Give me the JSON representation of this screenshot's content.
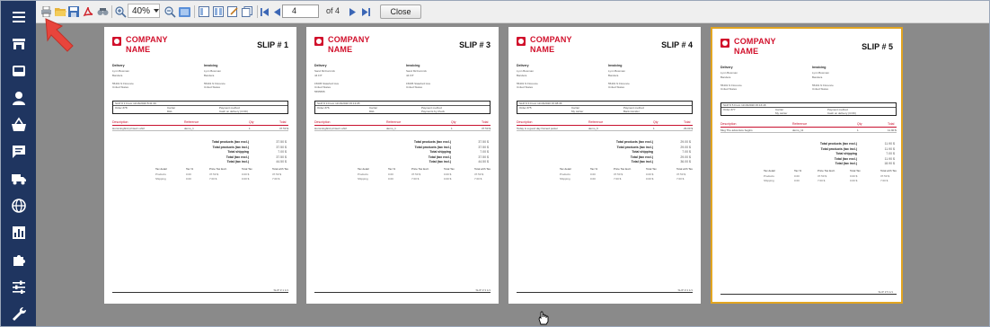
{
  "toolbar": {
    "zoom": "40%",
    "page": "4",
    "page_of": "of 4",
    "close_label": "Close"
  },
  "sidebar": {
    "items": [
      "menu-icon",
      "store-icon",
      "inbox-icon",
      "person-icon",
      "basket-icon",
      "chat-icon",
      "truck-icon",
      "globe-icon",
      "chart-icon",
      "puzzle-icon",
      "sliders-icon",
      "wrench-icon"
    ]
  },
  "colors": {
    "sidebar": "#1f3560",
    "brand_red": "#d1102b",
    "selection": "#e2a521",
    "annotation_arrow": "#e8453c"
  },
  "slips": [
    {
      "company_line1": "COMPANY",
      "company_line2": "NAME",
      "title": "SLIP # 1",
      "selected": false,
      "delivery_h": "Delivery",
      "invoicing_h": "Invoicing",
      "delivery_addr": "Lynn Bowman\nBandera\n\n55401 N Florence\nUnited States",
      "invoicing_addr": "Lynn Bowman\nBandera\n\n55401 N Florence\nUnited States",
      "info_top": "SLIP # 1 From 11/16/2020 8:31:39",
      "info_col1": "Order #78",
      "info_col2_h": "Carrier",
      "info_col2": "DHL",
      "info_col3_h": "Payment method",
      "info_col3": "Cash on delivery (COD)",
      "headers": [
        "Description",
        "Reference",
        "Qty",
        "Total"
      ],
      "product": [
        "Hummingbird printed t-shirt",
        "demo_1",
        "1",
        "37.50 $"
      ],
      "totals": [
        [
          "Total products (tax excl.)",
          "37.50 $"
        ],
        [
          "Total products (tax incl.)",
          "37.50 $"
        ],
        [
          "Total shipping",
          "7.00 $"
        ],
        [
          "Total (tax excl.)",
          "37.50 $"
        ],
        [
          "Total (tax incl.)",
          "44.50 $"
        ]
      ],
      "footer": "SLIP # 1 1/1"
    },
    {
      "company_line1": "COMPANY",
      "company_line2": "NAME",
      "title": "SLIP # 3",
      "selected": false,
      "delivery_h": "Delivery",
      "invoicing_h": "Invoicing",
      "delivery_addr": "Sand McCormick\n44 FIT\n\n15005 Stateford Ave\nUnited States\n5555555",
      "invoicing_addr": "Sand McCormick\n44 FIT\n\n15005 Stateford Ave\nUnited States",
      "info_top": "SLIP # 3 From 11/16/2020 15:13:05",
      "info_col1": "Order #76",
      "info_col2_h": "Carrier",
      "info_col2": "DHL",
      "info_col3_h": "Payment method",
      "info_col3": "Payments by check",
      "headers": [
        "Description",
        "Reference",
        "Qty",
        "Total"
      ],
      "product": [
        "Hummingbird printed t-shirt",
        "demo_1",
        "1",
        "37.50 $"
      ],
      "totals": [
        [
          "Total products (tax excl.)",
          "37.50 $"
        ],
        [
          "Total products (tax incl.)",
          "37.50 $"
        ],
        [
          "Total shipping",
          "7.00 $"
        ],
        [
          "Total (tax excl.)",
          "37.50 $"
        ],
        [
          "Total (tax incl.)",
          "44.50 $"
        ]
      ],
      "footer": "SLIP # 3 1/1"
    },
    {
      "company_line1": "COMPANY",
      "company_line2": "NAME",
      "title": "SLIP # 4",
      "selected": false,
      "delivery_h": "Delivery",
      "invoicing_h": "Invoicing",
      "delivery_addr": "Lynn Bowman\nBandera\n\n55401 N Florence\nUnited States",
      "invoicing_addr": "Lynn Bowman\nBandera\n\n55401 N Florence\nUnited States",
      "info_top": "SLIP # 4 From 11/16/2020 15:08:36",
      "info_col1": "Order #75",
      "info_col2_h": "Carrier",
      "info_col2": "My carrier",
      "info_col3_h": "Payment method",
      "info_col3": "Bank transfer",
      "headers": [
        "Description",
        "Reference",
        "Qty",
        "Total"
      ],
      "product": [
        "Today is a good day framed poster",
        "demo_6",
        "1",
        "29.00 $"
      ],
      "totals": [
        [
          "Total products (tax excl.)",
          "29.00 $"
        ],
        [
          "Total products (tax incl.)",
          "29.00 $"
        ],
        [
          "Total shipping",
          "7.00 $"
        ],
        [
          "Total (tax excl.)",
          "29.00 $"
        ],
        [
          "Total (tax incl.)",
          "36.00 $"
        ]
      ],
      "footer": "SLIP # 4 1/1"
    },
    {
      "company_line1": "COMPANY",
      "company_line2": "NAME",
      "title": "SLIP # 5",
      "selected": true,
      "delivery_h": "Delivery",
      "invoicing_h": "Invoicing",
      "delivery_addr": "Lynn Bowman\nBandera\n\n55401 N Florence\nUnited States",
      "invoicing_addr": "Lynn Bowman\nBandera\n\n55401 N Florence\nUnited States",
      "info_top": "SLIP # 5 From 11/16/2020 15:16:18",
      "info_col1": "Order #77",
      "info_col2_h": "Carrier",
      "info_col2": "My carrier",
      "info_col3_h": "Payment method",
      "info_col3": "Cash on delivery (COD)",
      "headers": [
        "Description",
        "Reference",
        "Qty",
        "Total"
      ],
      "product": [
        "Mug The adventure begins",
        "demo_11",
        "1",
        "11.90 $"
      ],
      "totals": [
        [
          "Total products (tax excl.)",
          "11.90 $"
        ],
        [
          "Total products (tax incl.)",
          "11.90 $"
        ],
        [
          "Total shipping",
          "7.00 $"
        ],
        [
          "Total (tax excl.)",
          "11.90 $"
        ],
        [
          "Total (tax incl.)",
          "18.90 $"
        ]
      ],
      "footer": "SLIP # 5 1/1"
    }
  ],
  "tax_headers": [
    "Tax detail",
    "Tax %",
    "Price Tax Excl.",
    "Total Tax",
    "Total with Tax"
  ],
  "tax_rows": [
    [
      "Products",
      "0.00",
      "37.50 $",
      "0.00 $",
      "37.50 $"
    ],
    [
      "Shipping",
      "0.00",
      "7.00 $",
      "0.00 $",
      "7.00 $"
    ]
  ]
}
